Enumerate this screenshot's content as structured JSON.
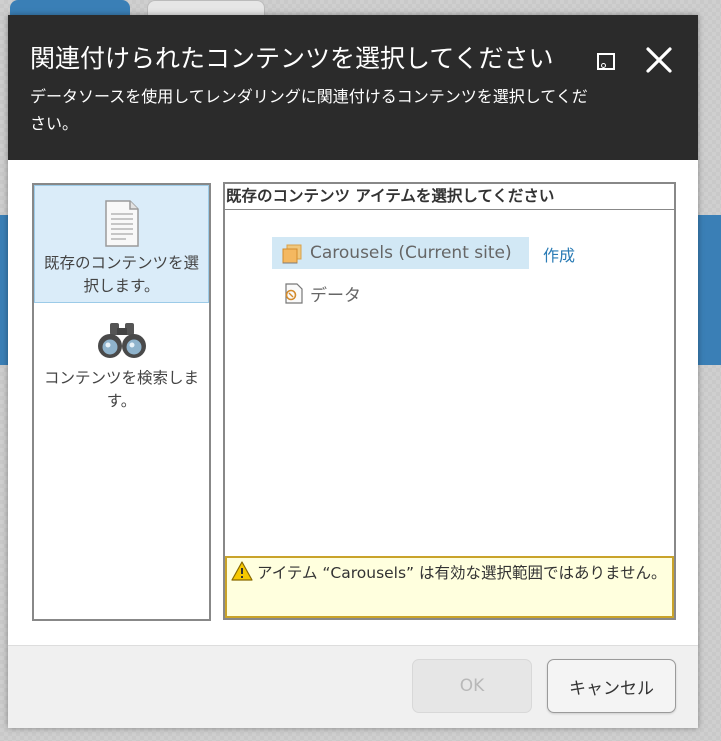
{
  "dialog": {
    "title": "関連付けられたコンテンツを選択してください",
    "subtitle": "データソースを使用してレンダリングに関連付けるコンテンツを選択してください。",
    "maximize_icon": "maximize-icon",
    "close_icon": "close-icon"
  },
  "sidebar": {
    "items": [
      {
        "label": "既存のコンテンツを選択します。",
        "icon": "document-icon",
        "active": true
      },
      {
        "label": "コンテンツを検索します。",
        "icon": "binoculars-icon",
        "active": false
      }
    ]
  },
  "main": {
    "header": "既存のコンテンツ アイテムを選択してください",
    "tree": [
      {
        "label": "Carousels (Current site)",
        "icon": "carousel-folder-icon",
        "selected": true
      },
      {
        "label": "データ",
        "icon": "data-folder-icon",
        "selected": false
      }
    ],
    "create_link": "作成",
    "warning": {
      "icon": "warning-icon",
      "text": "アイテム “Carousels” は有効な選択範囲ではありません。"
    }
  },
  "footer": {
    "ok_label": "OK",
    "cancel_label": "キャンセル"
  },
  "colors": {
    "header_bg": "#2b2b2b",
    "selected_bg": "#d2e8f5",
    "link": "#2a7bb5",
    "warning_bg": "#ffffde",
    "warning_border": "#c9a32a"
  }
}
